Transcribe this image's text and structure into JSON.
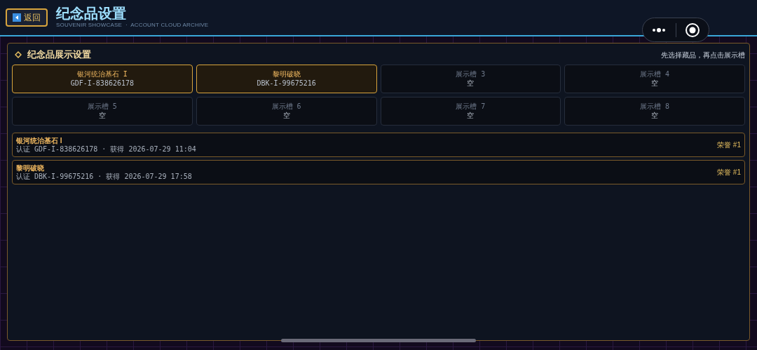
{
  "header": {
    "back_label": "返回",
    "title": "纪念品设置",
    "subtitle": "SOUVENIR SHOWCASE  ·  ACCOUNT CLOUD ARCHIVE"
  },
  "panel": {
    "title": "纪念品展示设置",
    "hint": "先选择藏品，再点击展示槽",
    "slots": [
      {
        "name": "银河统治基石 I",
        "code": "GDF-I-838626178",
        "filled": true
      },
      {
        "name": "黎明破晓",
        "code": "DBK-I-99675216",
        "filled": true
      },
      {
        "name": "展示槽 3",
        "code": "空",
        "filled": false
      },
      {
        "name": "展示槽 4",
        "code": "空",
        "filled": false
      },
      {
        "name": "展示槽 5",
        "code": "空",
        "filled": false
      },
      {
        "name": "展示槽 6",
        "code": "空",
        "filled": false
      },
      {
        "name": "展示槽 7",
        "code": "空",
        "filled": false
      },
      {
        "name": "展示槽 8",
        "code": "空",
        "filled": false
      }
    ],
    "items": [
      {
        "name": "银河统治基石 I",
        "meta": "认证 GDF-I-838626178 · 获得 2026-07-29 11:04",
        "rank": "荣誉 #1"
      },
      {
        "name": "黎明破晓",
        "meta": "认证 DBK-I-99675216 · 获得 2026-07-29 17:58",
        "rank": "荣誉 #1"
      }
    ]
  }
}
